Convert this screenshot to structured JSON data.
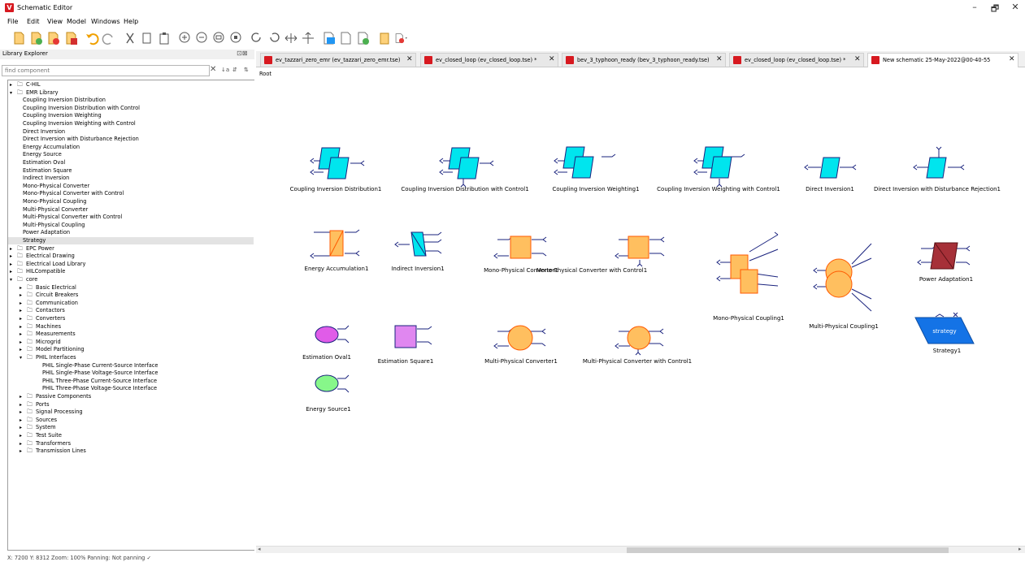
{
  "window": {
    "title": "Schematic Editor",
    "minimize": "–",
    "maximize": "🗗",
    "close": "✕"
  },
  "menu": [
    "File",
    "Edit",
    "View",
    "Model",
    "Windows",
    "Help"
  ],
  "sidebar": {
    "title": "Library Explorer",
    "header_icons": "⊡⊠",
    "search_placeholder": "find component",
    "tree": [
      {
        "label": "C-HIL",
        "level": 0,
        "type": "folder",
        "expanded": false
      },
      {
        "label": "EMR Library",
        "level": 0,
        "type": "folder",
        "expanded": true
      },
      {
        "label": "Coupling Inversion Distribution",
        "level": 1,
        "type": "item"
      },
      {
        "label": "Coupling Inversion Distribution with Control",
        "level": 1,
        "type": "item"
      },
      {
        "label": "Coupling Inversion Weighting",
        "level": 1,
        "type": "item"
      },
      {
        "label": "Coupling Inversion Weighting with Control",
        "level": 1,
        "type": "item"
      },
      {
        "label": "Direct Inversion",
        "level": 1,
        "type": "item"
      },
      {
        "label": "Direct Inversion with Disturbance Rejection",
        "level": 1,
        "type": "item"
      },
      {
        "label": "Energy Accumulation",
        "level": 1,
        "type": "item"
      },
      {
        "label": "Energy Source",
        "level": 1,
        "type": "item"
      },
      {
        "label": "Estimation Oval",
        "level": 1,
        "type": "item"
      },
      {
        "label": "Estimation Square",
        "level": 1,
        "type": "item"
      },
      {
        "label": "Indirect Inversion",
        "level": 1,
        "type": "item"
      },
      {
        "label": "Mono-Physical Converter",
        "level": 1,
        "type": "item"
      },
      {
        "label": "Mono-Physical Converter with Control",
        "level": 1,
        "type": "item"
      },
      {
        "label": "Mono-Physical Coupling",
        "level": 1,
        "type": "item"
      },
      {
        "label": "Multi-Physical Converter",
        "level": 1,
        "type": "item"
      },
      {
        "label": "Multi-Physical Converter with Control",
        "level": 1,
        "type": "item"
      },
      {
        "label": "Multi-Physical Coupling",
        "level": 1,
        "type": "item"
      },
      {
        "label": "Power Adaptation",
        "level": 1,
        "type": "item"
      },
      {
        "label": "Strategy",
        "level": 1,
        "type": "item",
        "selected": true
      },
      {
        "label": "EPC Power",
        "level": 0,
        "type": "folder",
        "expanded": false
      },
      {
        "label": "Electrical Drawing",
        "level": 0,
        "type": "folder",
        "expanded": false
      },
      {
        "label": "Electrical Load Library",
        "level": 0,
        "type": "folder",
        "expanded": false
      },
      {
        "label": "HILCompatible",
        "level": 0,
        "type": "folder",
        "expanded": false
      },
      {
        "label": "core",
        "level": 0,
        "type": "folder",
        "expanded": true
      },
      {
        "label": "Basic Electrical",
        "level": 1,
        "type": "folder",
        "expanded": false
      },
      {
        "label": "Circuit Breakers",
        "level": 1,
        "type": "folder",
        "expanded": false
      },
      {
        "label": "Communication",
        "level": 1,
        "type": "folder",
        "expanded": false
      },
      {
        "label": "Contactors",
        "level": 1,
        "type": "folder",
        "expanded": false
      },
      {
        "label": "Converters",
        "level": 1,
        "type": "folder",
        "expanded": false
      },
      {
        "label": "Machines",
        "level": 1,
        "type": "folder",
        "expanded": false
      },
      {
        "label": "Measurements",
        "level": 1,
        "type": "folder",
        "expanded": false
      },
      {
        "label": "Microgrid",
        "level": 1,
        "type": "folder",
        "expanded": false
      },
      {
        "label": "Model Partitioning",
        "level": 1,
        "type": "folder",
        "expanded": false
      },
      {
        "label": "PHIL Interfaces",
        "level": 1,
        "type": "folder",
        "expanded": true
      },
      {
        "label": "PHIL Single-Phase Current-Source Interface",
        "level": 2,
        "type": "item"
      },
      {
        "label": "PHIL Single-Phase Voltage-Source Interface",
        "level": 2,
        "type": "item"
      },
      {
        "label": "PHIL Three-Phase Current-Source Interface",
        "level": 2,
        "type": "item"
      },
      {
        "label": "PHIL Three-Phase Voltage-Source Interface",
        "level": 2,
        "type": "item"
      },
      {
        "label": "Passive Components",
        "level": 1,
        "type": "folder",
        "expanded": false
      },
      {
        "label": "Ports",
        "level": 1,
        "type": "folder",
        "expanded": false
      },
      {
        "label": "Signal Processing",
        "level": 1,
        "type": "folder",
        "expanded": false
      },
      {
        "label": "Sources",
        "level": 1,
        "type": "folder",
        "expanded": false
      },
      {
        "label": "System",
        "level": 1,
        "type": "folder",
        "expanded": false
      },
      {
        "label": "Test Suite",
        "level": 1,
        "type": "folder",
        "expanded": false
      },
      {
        "label": "Transformers",
        "level": 1,
        "type": "folder",
        "expanded": false
      },
      {
        "label": "Transmission Lines",
        "level": 1,
        "type": "folder",
        "expanded": false
      }
    ]
  },
  "tabs": [
    {
      "label": "ev_tazzari_zero_emr (ev_tazzari_zero_emr.tse)",
      "active": false
    },
    {
      "label": "ev_closed_loop (ev_closed_loop.tse) *",
      "active": false
    },
    {
      "label": "bev_3_typhoon_ready (bev_3_typhoon_ready.tse)",
      "active": false
    },
    {
      "label": "ev_closed_loop (ev_closed_loop.tse) *",
      "active": false
    },
    {
      "label": "New schematic 25-May-2022@00-40-55",
      "active": true
    }
  ],
  "breadcrumb": "Root",
  "components": [
    {
      "name": "Coupling Inversion Distribution1"
    },
    {
      "name": "Coupling Inversion Distribution with Control1"
    },
    {
      "name": "Coupling Inversion Weighting1"
    },
    {
      "name": "Coupling Inversion Weighting with Control1"
    },
    {
      "name": "Direct Inversion1"
    },
    {
      "name": "Direct Inversion with Disturbance Rejection1"
    },
    {
      "name": "Energy Accumulation1"
    },
    {
      "name": "Indirect Inversion1"
    },
    {
      "name": "Mono-Physical Converter1"
    },
    {
      "name": "Mono-Physical Converter with Control1"
    },
    {
      "name": "Mono-Physical Coupling1"
    },
    {
      "name": "Multi-Physical Coupling1"
    },
    {
      "name": "Power Adaptation1"
    },
    {
      "name": "Estimation Oval1"
    },
    {
      "name": "Estimation Square1"
    },
    {
      "name": "Multi-Physical Converter1"
    },
    {
      "name": "Multi-Physical Converter with Control1"
    },
    {
      "name": "Strategy1",
      "block_text": "strategy"
    },
    {
      "name": "Energy Source1"
    }
  ],
  "status": "X: 7200  Y: 8312  Zoom: 100%   Panning: Not panning  ✓",
  "colors": {
    "cyan": "#00e5ee",
    "orange": "#ffbf5f",
    "orange_border": "#ff5a00",
    "magenta": "#e05ce8",
    "violet": "#e087f0",
    "green": "#87f78a",
    "maroon": "#a63038",
    "blue": "#1473e6",
    "wire": "#1a237e"
  }
}
